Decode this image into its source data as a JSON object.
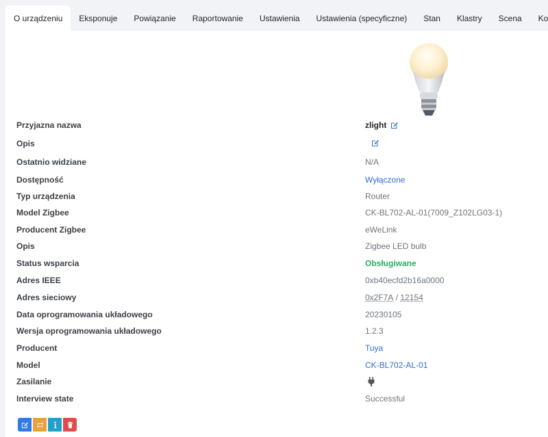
{
  "tabs": [
    {
      "label": "O urządzeniu",
      "active": true
    },
    {
      "label": "Eksponuje"
    },
    {
      "label": "Powiązanie"
    },
    {
      "label": "Raportowanie"
    },
    {
      "label": "Ustawienia"
    },
    {
      "label": "Ustawienia (specyficzne)"
    },
    {
      "label": "Stan"
    },
    {
      "label": "Klastry"
    },
    {
      "label": "Scena"
    },
    {
      "label": "Konsola"
    }
  ],
  "device_image_icon": "light-bulb-icon",
  "info": {
    "friendly_name": {
      "label": "Przyjazna nazwa",
      "value": "zlight"
    },
    "description_edit": {
      "label": "Opis",
      "value": ""
    },
    "last_seen": {
      "label": "Ostatnio widziane",
      "value": "N/A"
    },
    "availability": {
      "label": "Dostępność",
      "value": "Wyłączone"
    },
    "device_type": {
      "label": "Typ urządzenia",
      "value": "Router"
    },
    "zigbee_model": {
      "label": "Model Zigbee",
      "value": "CK-BL702-AL-01(7009_Z102LG03-1)"
    },
    "zigbee_manufacturer": {
      "label": "Producent Zigbee",
      "value": "eWeLink"
    },
    "description": {
      "label": "Opis",
      "value": "Zigbee LED bulb"
    },
    "support_status": {
      "label": "Status wsparcia",
      "value": "Obsługiwane"
    },
    "ieee_address": {
      "label": "Adres IEEE",
      "value": "0xb40ecfd2b16a0000"
    },
    "network_address": {
      "label": "Adres sieciowy",
      "hex": "0x2F7A",
      "separator": " / ",
      "dec": "12154"
    },
    "firmware_date": {
      "label": "Data oprogramowania układowego",
      "value": "20230105"
    },
    "firmware_version": {
      "label": "Wersja oprogramowania układowego",
      "value": "1.2.3"
    },
    "manufacturer": {
      "label": "Producent",
      "value": "Tuya"
    },
    "model": {
      "label": "Model",
      "value": "CK-BL702-AL-01"
    },
    "power": {
      "label": "Zasilanie",
      "icon": "plug-icon"
    },
    "interview_state": {
      "label": "Interview state",
      "value": "Successful"
    }
  },
  "colors": {
    "link": "#2f6fd0",
    "supported": "#27ae60",
    "btn_rename": "#2f7ae5",
    "btn_reconfigure": "#e8a33a",
    "btn_interview": "#1fa2c9",
    "btn_remove": "#e14b4b"
  },
  "actions": [
    {
      "icon": "edit-icon"
    },
    {
      "icon": "reconfigure-icon"
    },
    {
      "icon": "info-icon"
    },
    {
      "icon": "trash-icon"
    }
  ]
}
